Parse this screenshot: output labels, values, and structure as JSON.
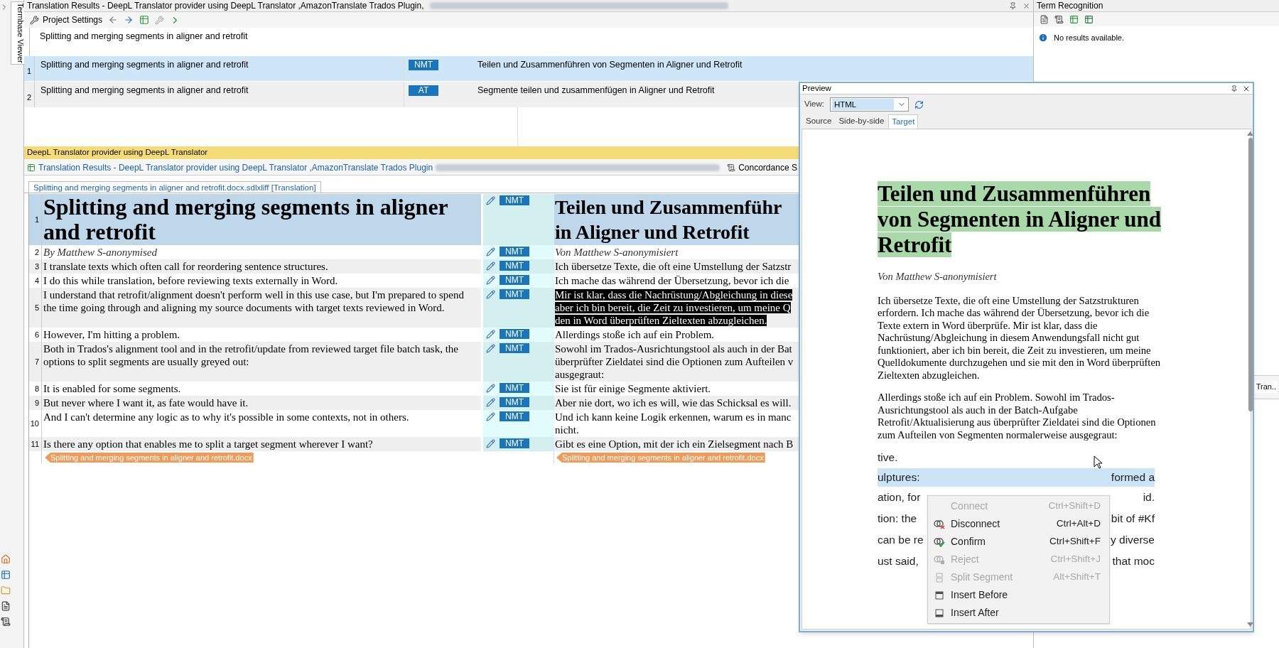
{
  "left_strip": {
    "tab": "Termbase Viewer"
  },
  "results_panel": {
    "title": "Translation Results - DeepL Translator provider using DeepL Translator ,AmazonTranslate Trados Plugin,",
    "project_settings": "Project Settings",
    "source": "Splitting and merging segments in aligner and retrofit",
    "results": [
      {
        "number": "1",
        "source": "Splitting and merging segments in aligner and retrofit",
        "origin": "NMT",
        "target": "Teilen und Zusammenführen von Segmenten in Aligner und Retrofit",
        "selected": true
      },
      {
        "number": "2",
        "source": "Splitting and merging segments in aligner and retrofit",
        "origin": "AT",
        "target": "Segmente teilen und zusammenfügen in Aligner und Retrofit",
        "selected": false
      }
    ],
    "provider_bar": "DeepL Translator provider using DeepL Translator"
  },
  "bottom_tabs": [
    {
      "label": "Translation Results - DeepL Translator provider using DeepL Translator ,AmazonTranslate Trados Plugin",
      "selected": true
    },
    {
      "label": "Concordance S",
      "selected": false
    }
  ],
  "document_tab": "Splitting and merging segments in aligner and retrofit.docx.sdlxliff [Translation]",
  "editor": {
    "segments": [
      {
        "number": "1",
        "kind": "heading",
        "selected": true,
        "source": "Splitting and merging segments in aligner and retrofit",
        "status": "NMT",
        "target_lines": [
          "Teilen und Zusammenführ",
          "in Aligner und Retrofit"
        ],
        "target_selected": false
      },
      {
        "number": "2",
        "kind": "byline",
        "selected": false,
        "source": "By Matthew S-anonymised",
        "status": "NMT",
        "target_lines": [
          "Von Matthew S-anonymisiert"
        ],
        "target_selected": false
      },
      {
        "number": "3",
        "kind": "body",
        "selected": false,
        "source": "I translate texts which often call for reordering sentence structures.",
        "status": "NMT",
        "target_lines": [
          "Ich übersetze Texte, die oft eine Umstellung der Satzstr"
        ],
        "target_selected": false
      },
      {
        "number": "4",
        "kind": "body",
        "selected": false,
        "source": "I do this while translation, before reviewing texts externally in Word.",
        "status": "NMT",
        "target_lines": [
          "Ich mache das während der Übersetzung, bevor ich die"
        ],
        "target_selected": false
      },
      {
        "number": "5",
        "kind": "body",
        "selected": false,
        "source": "I understand that retrofit/alignment doesn't perform well in this use case, but I'm prepared to spend the time going through and aligning my source documents with target texts reviewed in Word.",
        "status": "NMT",
        "target_lines": [
          "Mir ist klar, dass die Nachrüstung/Abgleichung in diese",
          "aber ich bin bereit, die Zeit zu investieren, um meine Q",
          "den in Word überprüften Zieltexten abzugleichen."
        ],
        "target_selected": true
      },
      {
        "number": "6",
        "kind": "body",
        "selected": false,
        "source": "However, I'm hitting a problem.",
        "status": "NMT",
        "target_lines": [
          "Allerdings stoße ich auf ein Problem."
        ],
        "target_selected": false
      },
      {
        "number": "7",
        "kind": "body",
        "selected": false,
        "source": "Both in Trados's alignment tool and in the retrofit/update from reviewed target file batch task, the options to split segments are usually greyed out:",
        "status": "NMT",
        "target_lines": [
          "Sowohl im Trados-Ausrichtungstool als auch in der Bat",
          "überprüfter Zieldatei sind die Optionen zum Aufteilen v",
          "ausgegraut:"
        ],
        "target_selected": false
      },
      {
        "number": "8",
        "kind": "body",
        "selected": false,
        "source": "It is enabled for some segments.",
        "status": "NMT",
        "target_lines": [
          "Sie ist für einige Segmente aktiviert."
        ],
        "target_selected": false
      },
      {
        "number": "9",
        "kind": "body",
        "selected": false,
        "source": "But never where I want it, as fate would have it.",
        "status": "NMT",
        "target_lines": [
          "Aber nie dort, wo ich es will, wie das Schicksal es will."
        ],
        "target_selected": false
      },
      {
        "number": "10",
        "kind": "body",
        "selected": false,
        "source": "And I can't determine any logic as to why it's possible in some contexts, not in others.",
        "status": "NMT",
        "target_lines": [
          "Und ich kann keine Logik erkennen, warum es in manc",
          "nicht."
        ],
        "target_selected": false
      },
      {
        "number": "11",
        "kind": "body",
        "selected": false,
        "source": "Is there any option that enables me to split a target segment wherever I want?",
        "status": "NMT",
        "target_lines": [
          "Gibt es eine Option, mit der ich ein Zielsegment nach B"
        ],
        "target_selected": false
      }
    ],
    "source_end_tag": "Splitting and merging segments in aligner and retrofit.docx",
    "target_end_tag": "Splitting and merging segments in aligner and retrofit.docx"
  },
  "term_recognition": {
    "title": "Term Recognition",
    "message": "No results available.",
    "bottom_tab": "Tran.."
  },
  "preview": {
    "title": "Preview",
    "view_label": "View:",
    "view_value": "HTML",
    "tabs": [
      {
        "label": "Source",
        "selected": false
      },
      {
        "label": "Side-by-side",
        "selected": false
      },
      {
        "label": "Target",
        "selected": true
      }
    ],
    "heading": "Teilen und Zusammenführen von Segmenten in Aligner und Retrofit",
    "byline": "Von Matthew S-anonymisiert",
    "paragraphs": [
      "Ich übersetze Texte, die oft eine Umstellung der Satzstrukturen erfordern. Ich mache das während der Übersetzung, bevor ich die Texte extern in Word überprüfe. Mir ist klar, dass die Nachrüstung/Abgleichung in diesem Anwendungsfall nicht gut funktioniert, aber ich bin bereit, die Zeit zu investieren, um meine Quelldokumente durchzugehen und sie mit den in Word überprüften Zieltexten abzugleichen.",
      "Allerdings stoße ich auf ein Problem. Sowohl im Trados-Ausrichtungstool als auch in der Batch-Aufgabe Retrofit/Aktualisierung aus überprüfter Zieldatei sind die Optionen zum Aufteilen von Segmenten normalerweise ausgegraut:"
    ],
    "lines": [
      {
        "left": "tive.",
        "highlighted": false
      },
      {
        "left": "ulptures:",
        "right": "formed a",
        "highlighted": true
      },
      {
        "left": "ation, for",
        "right": "id.",
        "highlighted": false
      },
      {
        "left": "tion: the",
        "right": "bit of #Kf",
        "highlighted": false
      },
      {
        "left": "can be re",
        "right": "y diverse",
        "highlighted": false
      },
      {
        "left": "ust said,",
        "right": "that moc",
        "highlighted": false
      }
    ],
    "context_menu": [
      {
        "kind": "connect",
        "label": "Connect",
        "shortcut": "Ctrl+Shift+D",
        "disabled": true
      },
      {
        "kind": "disconnect",
        "label": "Disconnect",
        "shortcut": "Ctrl+Alt+D",
        "disabled": false
      },
      {
        "kind": "confirm",
        "label": "Confirm",
        "shortcut": "Ctrl+Shift+F",
        "disabled": false
      },
      {
        "kind": "reject",
        "label": "Reject",
        "shortcut": "Ctrl+Shift+J",
        "disabled": true
      },
      {
        "kind": "split",
        "label": "Split Segment",
        "shortcut": "Alt+Shift+T",
        "disabled": true
      },
      {
        "kind": "insert_before",
        "label": "Insert Before",
        "disabled": false
      },
      {
        "kind": "insert_after",
        "label": "Insert After",
        "disabled": false
      }
    ]
  }
}
